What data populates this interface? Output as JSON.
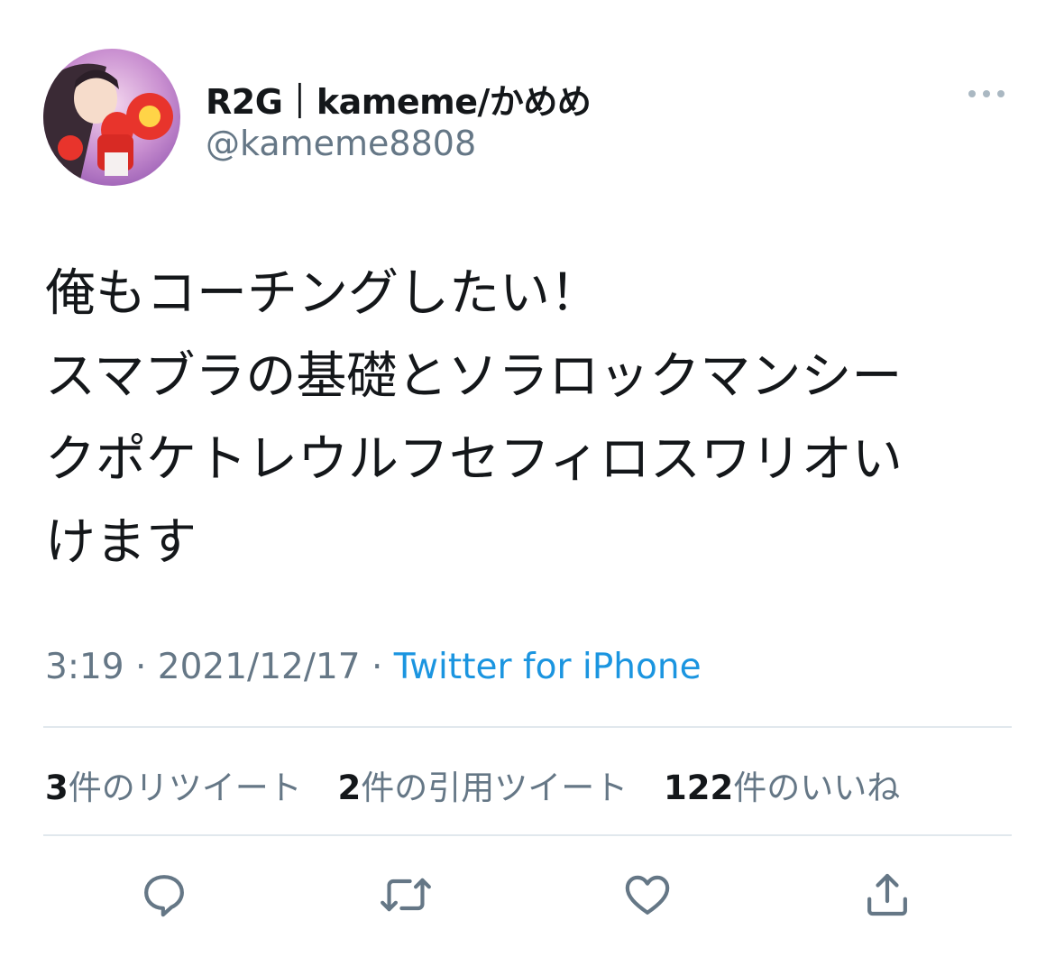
{
  "user": {
    "display_name": "R2G｜kameme/かめめ",
    "handle": "@kameme8808"
  },
  "tweet": {
    "lines": [
      "俺もコーチングしたい！",
      "スマブラの基礎とソラロックマンシー",
      "クポケトレウルフセフィロスワリオい",
      "けます"
    ]
  },
  "meta": {
    "time": "3:19",
    "sep1": " · ",
    "date": "2021/12/17",
    "sep2": " · ",
    "source": "Twitter for iPhone"
  },
  "stats": {
    "retweets_count": "3",
    "retweets_label": "件のリツイート",
    "quotes_count": "2",
    "quotes_label": "件の引用ツイート",
    "likes_count": "122",
    "likes_label": "件のいいね"
  },
  "icons": {
    "more": "more-horizontal-icon",
    "reply": "reply-icon",
    "retweet": "retweet-icon",
    "like": "heart-icon",
    "share": "share-icon"
  },
  "colors": {
    "text": "#14171a",
    "secondary": "#657786",
    "link": "#1b95e0",
    "divider": "#e1e8ed"
  }
}
